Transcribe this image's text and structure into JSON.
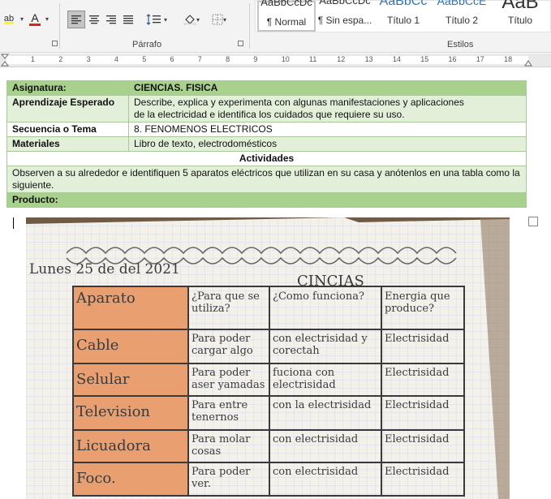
{
  "ribbon": {
    "font_color_label": "A",
    "paragraph_group_label": "Párrafo",
    "styles_group_label": "Estilos",
    "styles": [
      {
        "sample": "AaBbCcDc",
        "name": "¶ Normal"
      },
      {
        "sample": "AaBbCcDc",
        "name": "¶ Sin espa..."
      },
      {
        "sample": "AaBbCc",
        "name": "Título 1"
      },
      {
        "sample": "AaBbCcE",
        "name": "Título 2"
      },
      {
        "sample": "AaB",
        "name": "Título"
      }
    ]
  },
  "ruler": {
    "numbers": [
      "1",
      "2",
      "3",
      "4",
      "5",
      "6",
      "7",
      "8",
      "9",
      "10",
      "11",
      "12",
      "13",
      "14",
      "15",
      "16",
      "17",
      "18"
    ]
  },
  "table": {
    "asignatura_label": "Asignatura:",
    "asignatura_value": "CIENCIAS. FISICA",
    "aprendizaje_label": "Aprendizaje Esperado",
    "aprendizaje_value_1": "Describe, explica y experimenta con algunas manifestaciones y aplicaciones",
    "aprendizaje_value_2": "de la electricidad e identifica los cuidados que requiere su uso.",
    "secuencia_label": "Secuencia o Tema",
    "secuencia_value": "8. FENOMENOS ELECTRICOS",
    "materiales_label": "Materiales",
    "materiales_value": "Libro de texto, electrodomésticos",
    "actividades_label": "Actividades",
    "actividades_text": "Observen a su alrededor e identifiquen 5 aparatos eléctricos que utilizan en su casa y anótenlos en una tabla como la siguiente.",
    "producto_label": "Producto:"
  },
  "photo": {
    "date": "Lunes 25 de del 2021",
    "title": "CINCIAS",
    "headers": [
      "Aparato",
      "¿Para que se utiliza?",
      "¿Como funciona?",
      "Energia que produce?"
    ],
    "rows": [
      [
        "Cable",
        "Para poder cargar algo",
        "con electrisidad y corectah",
        "Electrisidad"
      ],
      [
        "Selular",
        "Para poder aser yamadas",
        "fuciona con electrisidad",
        "Electrisidad"
      ],
      [
        "Television",
        "Para entre tenernos",
        "con la electrisidad",
        "Electrisidad"
      ],
      [
        "Licuadora",
        "Para molar cosas",
        "con electrisidad",
        "Electrisidad"
      ],
      [
        "Foco.",
        "Para poder ver.",
        "con electrisidad",
        "Electrisidad"
      ]
    ]
  }
}
